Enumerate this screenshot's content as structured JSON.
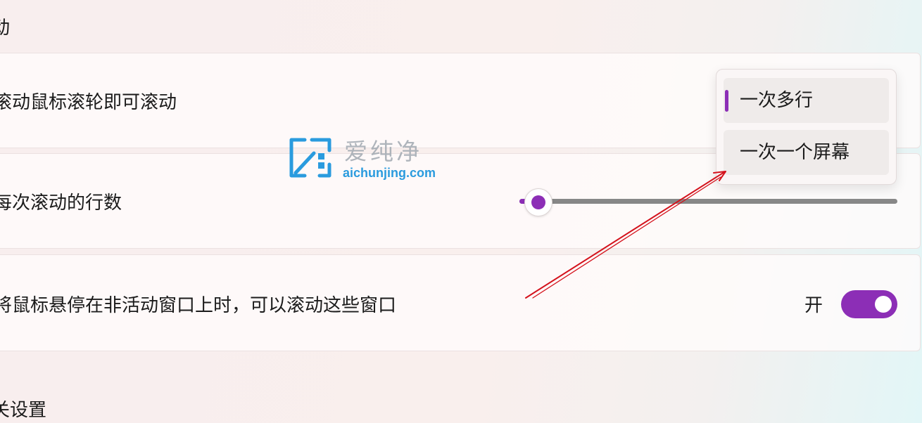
{
  "colors": {
    "accent": "#8c2eb6",
    "annotation_arrow": "#d4121c",
    "watermark_blue": "#2a9bde"
  },
  "section_title_top": "动",
  "section_title_bottom": "关设置",
  "settings": {
    "scroll_mode": {
      "label": "滚动鼠标滚轮即可滚动",
      "dropdown": {
        "selected": "一次多行",
        "options": [
          "一次多行",
          "一次一个屏幕"
        ]
      }
    },
    "lines_per_scroll": {
      "label": "每次滚动的行数",
      "slider_value_fraction": 0.05
    },
    "scroll_inactive_windows": {
      "label": "将鼠标悬停在非活动窗口上时，可以滚动这些窗口",
      "toggle_state_text": "开",
      "toggle_on": true
    }
  },
  "watermark": {
    "icon": "aichunjing-logo-icon",
    "title": "爱纯净",
    "url": "aichunjing.com"
  },
  "annotation": {
    "icon": "red-arrow-icon"
  }
}
